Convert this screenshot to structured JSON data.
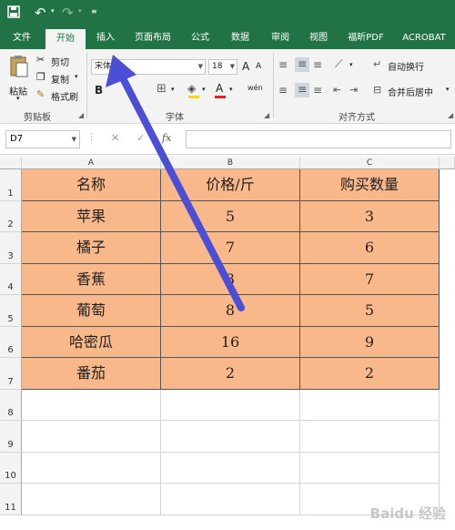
{
  "qat": {
    "save_icon": "save-icon",
    "undo_icon": "undo-icon",
    "redo_icon": "redo-icon",
    "customize_icon": "customize-icon"
  },
  "tabs": [
    {
      "label": "文件"
    },
    {
      "label": "开始"
    },
    {
      "label": "插入"
    },
    {
      "label": "页面布局"
    },
    {
      "label": "公式"
    },
    {
      "label": "数据"
    },
    {
      "label": "审阅"
    },
    {
      "label": "视图"
    },
    {
      "label": "福昕PDF"
    },
    {
      "label": "ACROBAT"
    }
  ],
  "ribbon": {
    "clipboard": {
      "paste": "粘贴",
      "cut": "剪切",
      "copy": "复制",
      "format_painter": "格式刷",
      "group": "剪贴板"
    },
    "font": {
      "font_name": "宋体",
      "font_size": "18",
      "bold": "B",
      "grow": "A",
      "shrink": "A",
      "font_color": "A",
      "phonetic": "wén",
      "group": "字体"
    },
    "alignment": {
      "wrap_text": "自动换行",
      "merge_center": "合并后居中",
      "group": "对齐方式"
    }
  },
  "formula_bar": {
    "name_box": "D7",
    "fx": "fx",
    "formula": ""
  },
  "sheet": {
    "columns": [
      "A",
      "B",
      "C"
    ],
    "rows": [
      "1",
      "2",
      "3",
      "4",
      "5",
      "6",
      "7",
      "8",
      "9",
      "10",
      "11"
    ],
    "data": [
      [
        "名称",
        "价格/斤",
        "购买数量"
      ],
      [
        "苹果",
        "5",
        "3"
      ],
      [
        "橘子",
        "7",
        "6"
      ],
      [
        "香蕉",
        "3",
        "7"
      ],
      [
        "葡萄",
        "8",
        "5"
      ],
      [
        "哈密瓜",
        "16",
        "9"
      ],
      [
        "番茄",
        "2",
        "2"
      ]
    ],
    "fill_color": "#f8b88a"
  },
  "annotation": {
    "arrow_color": "#4a4fd6"
  },
  "watermark": "Baidu 经验"
}
